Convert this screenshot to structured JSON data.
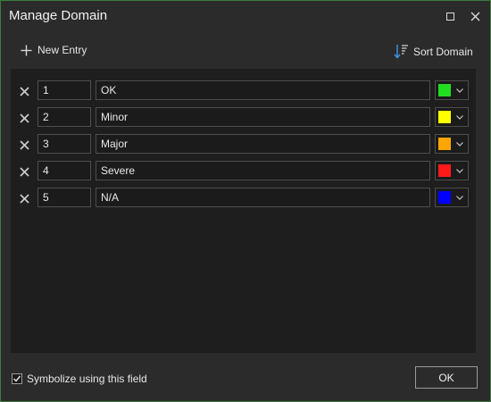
{
  "window": {
    "title": "Manage Domain"
  },
  "titlebar": {
    "maximize_icon": "maximize-icon",
    "close_icon": "close-icon"
  },
  "toolbar": {
    "new_entry_label": "New Entry",
    "sort_domain_label": "Sort Domain",
    "new_entry_icon": "plus-icon",
    "sort_icon": "sort-descending-icon"
  },
  "entries": [
    {
      "code": "1",
      "description": "OK",
      "color": "#22dd22"
    },
    {
      "code": "2",
      "description": "Minor",
      "color": "#ffff00"
    },
    {
      "code": "3",
      "description": "Major",
      "color": "#ffa500"
    },
    {
      "code": "4",
      "description": "Severe",
      "color": "#ff1a1a"
    },
    {
      "code": "5",
      "description": "N/A",
      "color": "#0000ff"
    }
  ],
  "footer": {
    "symbolize_label": "Symbolize using this field",
    "symbolize_checked": true,
    "ok_label": "OK"
  },
  "theme": {
    "background": "#2b2b2b",
    "panel": "#1e1e1e",
    "accent_border": "#3a7d3a",
    "sort_icon_color": "#3d9ae8"
  }
}
